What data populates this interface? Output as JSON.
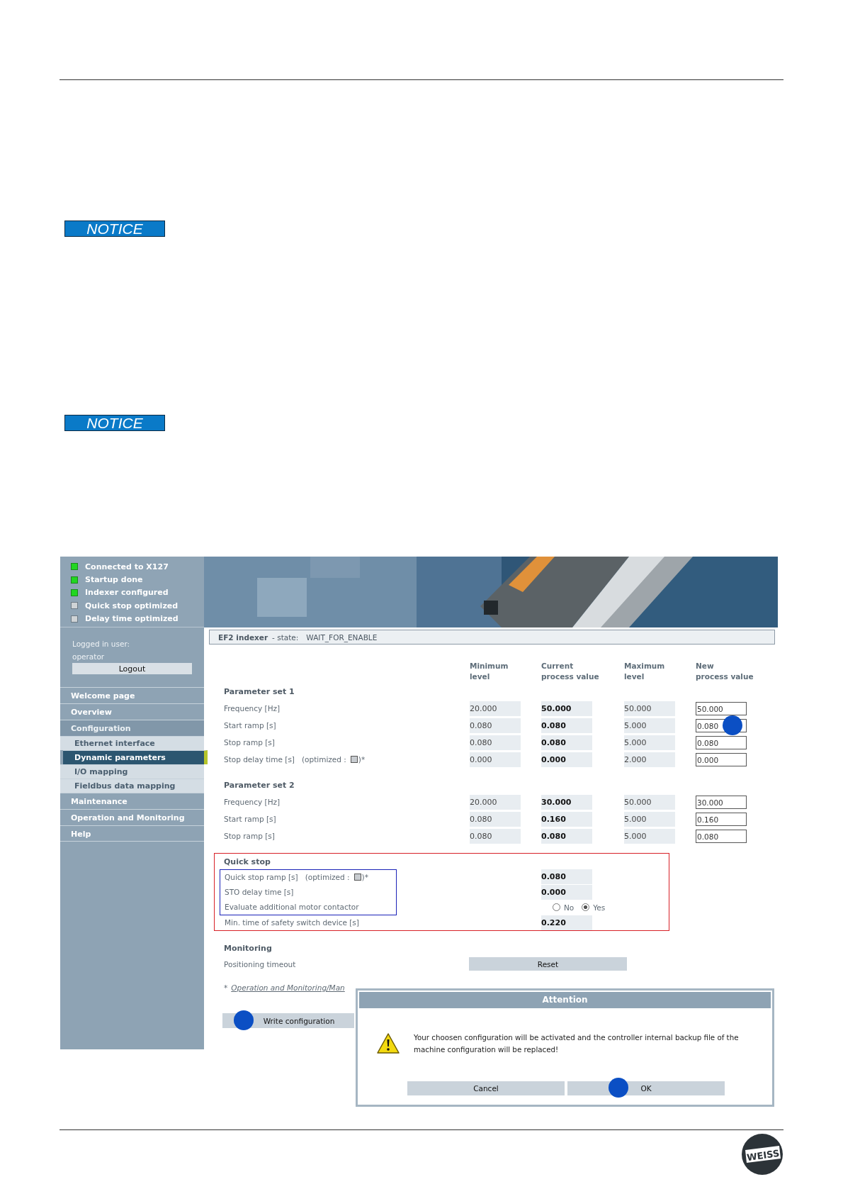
{
  "notices": [
    "NOTICE",
    "NOTICE"
  ],
  "status_items": [
    {
      "label": "Connected to X127",
      "on": true
    },
    {
      "label": "Startup done",
      "on": true
    },
    {
      "label": "Indexer configured",
      "on": true
    },
    {
      "label": "Quick stop optimized",
      "on": false
    },
    {
      "label": "Delay time optimized",
      "on": false
    }
  ],
  "login": {
    "label": "Logged in user:",
    "user": "operator",
    "logout_button": "Logout"
  },
  "nav": [
    {
      "label": "Welcome page",
      "kind": "main",
      "selected": false
    },
    {
      "label": "Overview",
      "kind": "main",
      "selected": false
    },
    {
      "label": "Configuration",
      "kind": "section",
      "selected": false
    },
    {
      "label": "Ethernet interface",
      "kind": "sub",
      "selected": false
    },
    {
      "label": "Dynamic parameters",
      "kind": "sub",
      "selected": true
    },
    {
      "label": "I/O mapping",
      "kind": "sub",
      "selected": false
    },
    {
      "label": "Fieldbus data mapping",
      "kind": "sub",
      "selected": false
    },
    {
      "label": "Maintenance",
      "kind": "main",
      "selected": false
    },
    {
      "label": "Operation and Monitoring",
      "kind": "main",
      "selected": false
    },
    {
      "label": "Help",
      "kind": "main",
      "selected": false
    }
  ],
  "state_bar": {
    "device": "EF2 indexer",
    "label": "- state:",
    "value": "WAIT_FOR_ENABLE"
  },
  "columns": [
    [
      "Minimum",
      "level"
    ],
    [
      "Current",
      "process value"
    ],
    [
      "Maximum",
      "level"
    ],
    [
      "New",
      "process value"
    ]
  ],
  "parameter_sets": [
    {
      "title": "Parameter set 1",
      "rows": [
        {
          "label": "Frequency [Hz]",
          "min": "20.000",
          "current": "50.000",
          "max": "50.000",
          "new": "50.000"
        },
        {
          "label": "Start ramp [s]",
          "min": "0.080",
          "current": "0.080",
          "max": "5.000",
          "new": "0.080"
        },
        {
          "label": "Stop ramp [s]",
          "min": "0.080",
          "current": "0.080",
          "max": "5.000",
          "new": "0.080"
        },
        {
          "label": "Stop delay time [s]",
          "optimized_label": "(optimized :",
          "optimized_suffix": ")*",
          "optimized": false,
          "min": "0.000",
          "current": "0.000",
          "max": "2.000",
          "new": "0.000"
        }
      ]
    },
    {
      "title": "Parameter set 2",
      "rows": [
        {
          "label": "Frequency [Hz]",
          "min": "20.000",
          "current": "30.000",
          "max": "50.000",
          "new": "30.000"
        },
        {
          "label": "Start ramp [s]",
          "min": "0.080",
          "current": "0.160",
          "max": "5.000",
          "new": "0.160"
        },
        {
          "label": "Stop ramp [s]",
          "min": "0.080",
          "current": "0.080",
          "max": "5.000",
          "new": "0.080"
        }
      ]
    }
  ],
  "quick_stop": {
    "title": "Quick stop",
    "rows": [
      {
        "kind": "value",
        "highlighted": true,
        "label": "Quick stop ramp [s]",
        "optimized_label": "(optimized :",
        "optimized_suffix": ")*",
        "optimized": false,
        "value": "0.080"
      },
      {
        "kind": "value",
        "highlighted": true,
        "label": "STO delay time [s]",
        "value": "0.000"
      },
      {
        "kind": "radio",
        "highlighted": true,
        "label": "Evaluate additional motor contactor",
        "options": [
          {
            "label": "No",
            "selected": false
          },
          {
            "label": "Yes",
            "selected": true
          }
        ]
      },
      {
        "kind": "value",
        "highlighted": false,
        "label": "Min. time of safety switch device [s]",
        "value": "0.220"
      }
    ]
  },
  "monitoring": {
    "title": "Monitoring",
    "rows": [
      {
        "label": "Positioning timeout",
        "button": "Reset"
      }
    ]
  },
  "footnote": {
    "mark": "*",
    "link": "Operation and Monitoring/Man"
  },
  "write_button": "Write configuration",
  "dialog": {
    "title": "Attention",
    "message": "Your choosen configuration will be activated and the controller internal backup file of the machine configuration will be replaced!",
    "buttons": [
      "Cancel",
      "OK"
    ]
  },
  "logo": "WEISS"
}
